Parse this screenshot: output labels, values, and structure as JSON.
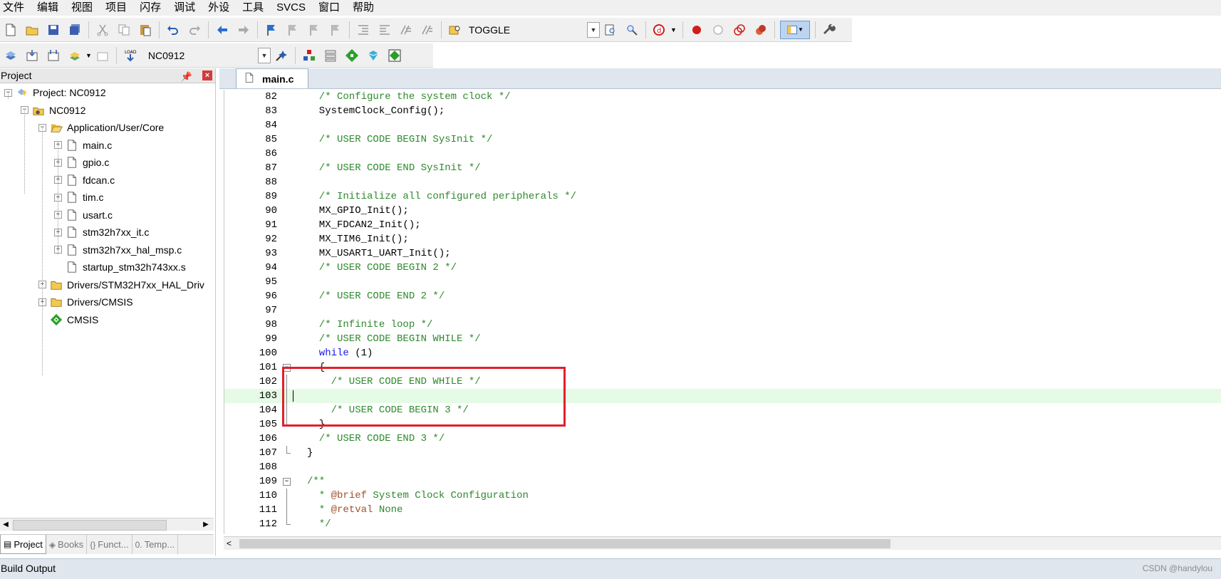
{
  "menu": [
    "文件",
    "编辑",
    "视图",
    "项目",
    "闪存",
    "调试",
    "外设",
    "工具",
    "SVCS",
    "窗口",
    "帮助"
  ],
  "toolbar1": {
    "find_combo_value": "TOGGLE"
  },
  "toolbar2": {
    "target_combo_value": "NC0912"
  },
  "project_panel": {
    "title": "Project",
    "tree": [
      {
        "label": "Project: NC0912",
        "icon": "project-icon",
        "level": 0,
        "expander": "−"
      },
      {
        "label": "NC0912",
        "icon": "target-icon",
        "level": 1,
        "expander": "−"
      },
      {
        "label": "Application/User/Core",
        "icon": "folder-open-icon",
        "level": 2,
        "expander": "−"
      },
      {
        "label": "main.c",
        "icon": "file-icon",
        "level": 3,
        "expander": "+"
      },
      {
        "label": "gpio.c",
        "icon": "file-icon",
        "level": 3,
        "expander": "+"
      },
      {
        "label": "fdcan.c",
        "icon": "file-icon",
        "level": 3,
        "expander": "+"
      },
      {
        "label": "tim.c",
        "icon": "file-icon",
        "level": 3,
        "expander": "+"
      },
      {
        "label": "usart.c",
        "icon": "file-icon",
        "level": 3,
        "expander": "+"
      },
      {
        "label": "stm32h7xx_it.c",
        "icon": "file-icon",
        "level": 3,
        "expander": "+"
      },
      {
        "label": "stm32h7xx_hal_msp.c",
        "icon": "file-icon",
        "level": 3,
        "expander": "+"
      },
      {
        "label": "startup_stm32h743xx.s",
        "icon": "file-icon",
        "level": 3,
        "expander": ""
      },
      {
        "label": "Drivers/STM32H7xx_HAL_Driv",
        "icon": "folder-icon",
        "level": 2,
        "expander": "+"
      },
      {
        "label": "Drivers/CMSIS",
        "icon": "folder-icon",
        "level": 2,
        "expander": "+"
      },
      {
        "label": "CMSIS",
        "icon": "cmsis-diamond-icon",
        "level": 2,
        "expander": ""
      }
    ],
    "tabs": [
      {
        "label": "Project",
        "icon": "project-tab-icon",
        "active": true
      },
      {
        "label": "Books",
        "icon": "books-tab-icon",
        "active": false
      },
      {
        "label": "Funct...",
        "icon": "functions-tab-icon",
        "active": false
      },
      {
        "label": "Temp...",
        "icon": "templates-tab-icon",
        "active": false
      }
    ]
  },
  "editor": {
    "active_tab": "main.c",
    "lines": [
      {
        "num": "82",
        "text": "  /* Configure the system clock */",
        "cls": "c-comment"
      },
      {
        "num": "83",
        "text": "  SystemClock_Config();",
        "cls": "c-normal"
      },
      {
        "num": "84",
        "text": "",
        "cls": "c-normal"
      },
      {
        "num": "85",
        "text": "  /* USER CODE BEGIN SysInit */",
        "cls": "c-comment"
      },
      {
        "num": "86",
        "text": "",
        "cls": "c-normal"
      },
      {
        "num": "87",
        "text": "  /* USER CODE END SysInit */",
        "cls": "c-comment"
      },
      {
        "num": "88",
        "text": "",
        "cls": "c-normal"
      },
      {
        "num": "89",
        "text": "  /* Initialize all configured peripherals */",
        "cls": "c-comment"
      },
      {
        "num": "90",
        "text": "  MX_GPIO_Init();",
        "cls": "c-normal"
      },
      {
        "num": "91",
        "text": "  MX_FDCAN2_Init();",
        "cls": "c-normal"
      },
      {
        "num": "92",
        "text": "  MX_TIM6_Init();",
        "cls": "c-normal"
      },
      {
        "num": "93",
        "text": "  MX_USART1_UART_Init();",
        "cls": "c-normal"
      },
      {
        "num": "94",
        "text": "  /* USER CODE BEGIN 2 */",
        "cls": "c-comment"
      },
      {
        "num": "95",
        "text": "",
        "cls": "c-normal"
      },
      {
        "num": "96",
        "text": "  /* USER CODE END 2 */",
        "cls": "c-comment"
      },
      {
        "num": "97",
        "text": "",
        "cls": "c-normal"
      },
      {
        "num": "98",
        "text": "  /* Infinite loop */",
        "cls": "c-comment"
      },
      {
        "num": "99",
        "text": "  /* USER CODE BEGIN WHILE */",
        "cls": "c-comment"
      },
      {
        "num": "100",
        "text": "  while",
        "cls": "c-keyword",
        "suffix": " (1)"
      },
      {
        "num": "101",
        "text": "  {",
        "cls": "c-normal"
      },
      {
        "num": "102",
        "text": "    /* USER CODE END WHILE */",
        "cls": "c-comment"
      },
      {
        "num": "103",
        "text": "",
        "cls": "c-normal"
      },
      {
        "num": "104",
        "text": "    /* USER CODE BEGIN 3 */",
        "cls": "c-comment"
      },
      {
        "num": "105",
        "text": "  }",
        "cls": "c-normal"
      },
      {
        "num": "106",
        "text": "  /* USER CODE END 3 */",
        "cls": "c-comment"
      },
      {
        "num": "107",
        "text": "}",
        "cls": "c-normal"
      },
      {
        "num": "108",
        "text": "",
        "cls": "c-normal"
      },
      {
        "num": "109",
        "text": "/**",
        "cls": "c-comment"
      },
      {
        "num": "110",
        "text": "  * ",
        "cls": "c-comment",
        "tag": "@brief",
        "suffix": " System Clock Configuration"
      },
      {
        "num": "111",
        "text": "  * ",
        "cls": "c-comment",
        "tag": "@retval",
        "suffix": " None"
      },
      {
        "num": "112",
        "text": "  */",
        "cls": "c-comment"
      }
    ]
  },
  "build_output": {
    "title": "Build Output",
    "watermark": "CSDN @handylou"
  },
  "colors": {
    "comment": "#2c8a2c",
    "keyword": "#1919e6",
    "current_line": "#e6fbe6",
    "highlight_box": "#e0202a"
  }
}
